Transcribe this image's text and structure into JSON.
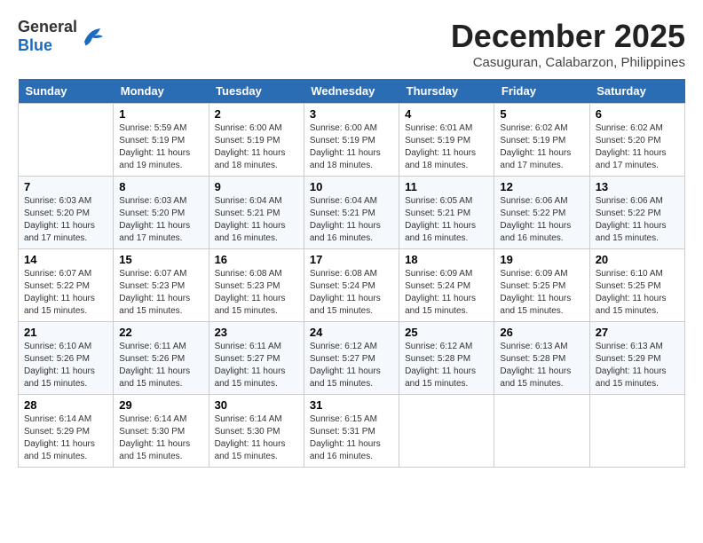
{
  "logo": {
    "general": "General",
    "blue": "Blue"
  },
  "header": {
    "month": "December 2025",
    "location": "Casuguran, Calabarzon, Philippines"
  },
  "weekdays": [
    "Sunday",
    "Monday",
    "Tuesday",
    "Wednesday",
    "Thursday",
    "Friday",
    "Saturday"
  ],
  "weeks": [
    [
      {
        "day": "",
        "info": ""
      },
      {
        "day": "1",
        "info": "Sunrise: 5:59 AM\nSunset: 5:19 PM\nDaylight: 11 hours\nand 19 minutes."
      },
      {
        "day": "2",
        "info": "Sunrise: 6:00 AM\nSunset: 5:19 PM\nDaylight: 11 hours\nand 18 minutes."
      },
      {
        "day": "3",
        "info": "Sunrise: 6:00 AM\nSunset: 5:19 PM\nDaylight: 11 hours\nand 18 minutes."
      },
      {
        "day": "4",
        "info": "Sunrise: 6:01 AM\nSunset: 5:19 PM\nDaylight: 11 hours\nand 18 minutes."
      },
      {
        "day": "5",
        "info": "Sunrise: 6:02 AM\nSunset: 5:19 PM\nDaylight: 11 hours\nand 17 minutes."
      },
      {
        "day": "6",
        "info": "Sunrise: 6:02 AM\nSunset: 5:20 PM\nDaylight: 11 hours\nand 17 minutes."
      }
    ],
    [
      {
        "day": "7",
        "info": "Sunrise: 6:03 AM\nSunset: 5:20 PM\nDaylight: 11 hours\nand 17 minutes."
      },
      {
        "day": "8",
        "info": "Sunrise: 6:03 AM\nSunset: 5:20 PM\nDaylight: 11 hours\nand 17 minutes."
      },
      {
        "day": "9",
        "info": "Sunrise: 6:04 AM\nSunset: 5:21 PM\nDaylight: 11 hours\nand 16 minutes."
      },
      {
        "day": "10",
        "info": "Sunrise: 6:04 AM\nSunset: 5:21 PM\nDaylight: 11 hours\nand 16 minutes."
      },
      {
        "day": "11",
        "info": "Sunrise: 6:05 AM\nSunset: 5:21 PM\nDaylight: 11 hours\nand 16 minutes."
      },
      {
        "day": "12",
        "info": "Sunrise: 6:06 AM\nSunset: 5:22 PM\nDaylight: 11 hours\nand 16 minutes."
      },
      {
        "day": "13",
        "info": "Sunrise: 6:06 AM\nSunset: 5:22 PM\nDaylight: 11 hours\nand 15 minutes."
      }
    ],
    [
      {
        "day": "14",
        "info": "Sunrise: 6:07 AM\nSunset: 5:22 PM\nDaylight: 11 hours\nand 15 minutes."
      },
      {
        "day": "15",
        "info": "Sunrise: 6:07 AM\nSunset: 5:23 PM\nDaylight: 11 hours\nand 15 minutes."
      },
      {
        "day": "16",
        "info": "Sunrise: 6:08 AM\nSunset: 5:23 PM\nDaylight: 11 hours\nand 15 minutes."
      },
      {
        "day": "17",
        "info": "Sunrise: 6:08 AM\nSunset: 5:24 PM\nDaylight: 11 hours\nand 15 minutes."
      },
      {
        "day": "18",
        "info": "Sunrise: 6:09 AM\nSunset: 5:24 PM\nDaylight: 11 hours\nand 15 minutes."
      },
      {
        "day": "19",
        "info": "Sunrise: 6:09 AM\nSunset: 5:25 PM\nDaylight: 11 hours\nand 15 minutes."
      },
      {
        "day": "20",
        "info": "Sunrise: 6:10 AM\nSunset: 5:25 PM\nDaylight: 11 hours\nand 15 minutes."
      }
    ],
    [
      {
        "day": "21",
        "info": "Sunrise: 6:10 AM\nSunset: 5:26 PM\nDaylight: 11 hours\nand 15 minutes."
      },
      {
        "day": "22",
        "info": "Sunrise: 6:11 AM\nSunset: 5:26 PM\nDaylight: 11 hours\nand 15 minutes."
      },
      {
        "day": "23",
        "info": "Sunrise: 6:11 AM\nSunset: 5:27 PM\nDaylight: 11 hours\nand 15 minutes."
      },
      {
        "day": "24",
        "info": "Sunrise: 6:12 AM\nSunset: 5:27 PM\nDaylight: 11 hours\nand 15 minutes."
      },
      {
        "day": "25",
        "info": "Sunrise: 6:12 AM\nSunset: 5:28 PM\nDaylight: 11 hours\nand 15 minutes."
      },
      {
        "day": "26",
        "info": "Sunrise: 6:13 AM\nSunset: 5:28 PM\nDaylight: 11 hours\nand 15 minutes."
      },
      {
        "day": "27",
        "info": "Sunrise: 6:13 AM\nSunset: 5:29 PM\nDaylight: 11 hours\nand 15 minutes."
      }
    ],
    [
      {
        "day": "28",
        "info": "Sunrise: 6:14 AM\nSunset: 5:29 PM\nDaylight: 11 hours\nand 15 minutes."
      },
      {
        "day": "29",
        "info": "Sunrise: 6:14 AM\nSunset: 5:30 PM\nDaylight: 11 hours\nand 15 minutes."
      },
      {
        "day": "30",
        "info": "Sunrise: 6:14 AM\nSunset: 5:30 PM\nDaylight: 11 hours\nand 15 minutes."
      },
      {
        "day": "31",
        "info": "Sunrise: 6:15 AM\nSunset: 5:31 PM\nDaylight: 11 hours\nand 16 minutes."
      },
      {
        "day": "",
        "info": ""
      },
      {
        "day": "",
        "info": ""
      },
      {
        "day": "",
        "info": ""
      }
    ]
  ]
}
